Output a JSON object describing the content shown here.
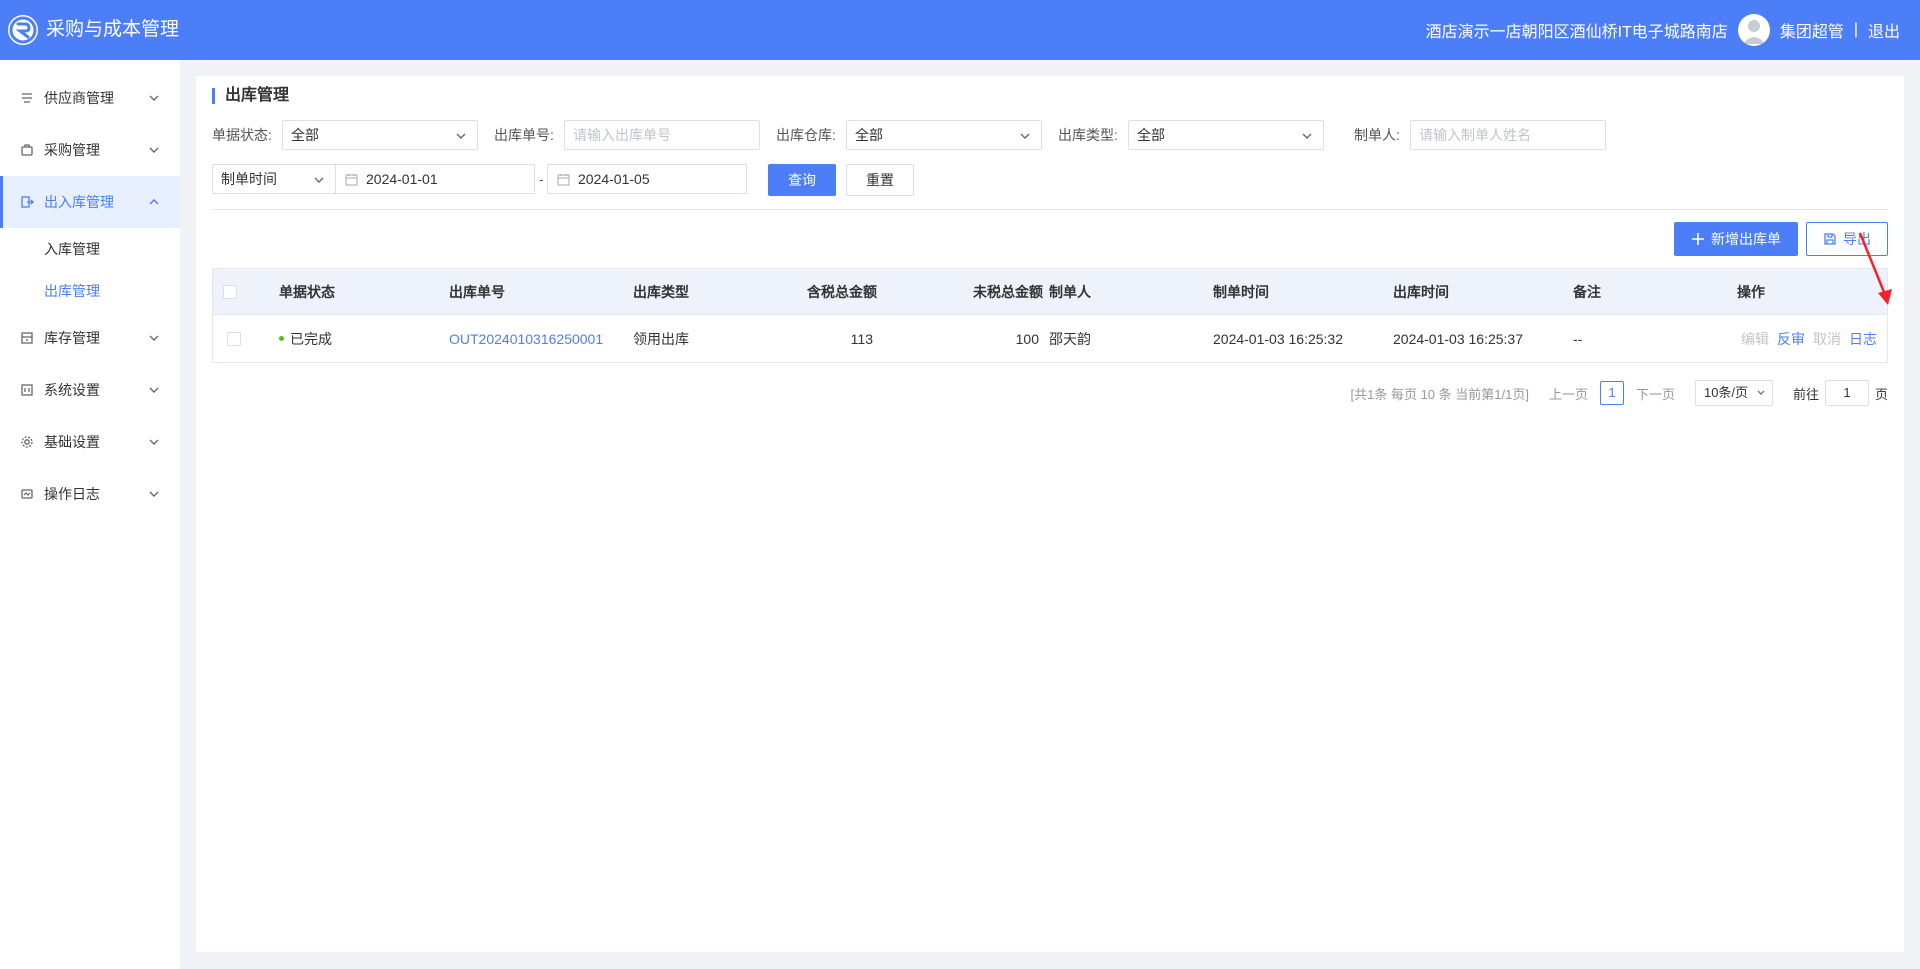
{
  "app": {
    "title": "采购与成本管理"
  },
  "header": {
    "store": "酒店演示一店朝阳区酒仙桥IT电子城路南店",
    "user": "集团超管",
    "separator": "|",
    "logout": "退出"
  },
  "sidebar": {
    "items": [
      {
        "label": "供应商管理",
        "icon": "supplier-icon"
      },
      {
        "label": "采购管理",
        "icon": "purchase-icon"
      },
      {
        "label": "出入库管理",
        "icon": "inout-icon",
        "active": true,
        "children": [
          {
            "label": "入库管理"
          },
          {
            "label": "出库管理",
            "active": true
          }
        ]
      },
      {
        "label": "库存管理",
        "icon": "inventory-icon"
      },
      {
        "label": "系统设置",
        "icon": "system-icon"
      },
      {
        "label": "基础设置",
        "icon": "gear-icon"
      },
      {
        "label": "操作日志",
        "icon": "log-icon"
      }
    ]
  },
  "page": {
    "title": "出库管理"
  },
  "filters": {
    "status": {
      "label": "单据状态:",
      "value": "全部"
    },
    "order_no": {
      "label": "出库单号:",
      "placeholder": "请输入出库单号"
    },
    "warehouse": {
      "label": "出库仓库:",
      "value": "全部"
    },
    "type": {
      "label": "出库类型:",
      "value": "全部"
    },
    "creator": {
      "label": "制单人:",
      "placeholder": "请输入制单人姓名"
    },
    "time_type": {
      "value": "制单时间"
    },
    "date_from": "2024-01-01",
    "date_sep": "-",
    "date_to": "2024-01-05",
    "query": "查询",
    "reset": "重置"
  },
  "actions": {
    "add": "新增出库单",
    "export": "导出"
  },
  "table": {
    "headers": {
      "status": "单据状态",
      "order_no": "出库单号",
      "type": "出库类型",
      "tax_total": "含税总金额",
      "notax_total": "未税总金额",
      "creator": "制单人",
      "created_at": "制单时间",
      "out_at": "出库时间",
      "remark": "备注",
      "ops": "操作"
    },
    "rows": [
      {
        "status": "已完成",
        "order_no": "OUT2024010316250001",
        "type": "领用出库",
        "tax_total": "113",
        "notax_total": "100",
        "creator": "邵天韵",
        "created_at": "2024-01-03 16:25:32",
        "out_at": "2024-01-03 16:25:37",
        "remark": "--",
        "ops": {
          "edit": "编辑",
          "reverse": "反审",
          "cancel": "取消",
          "log": "日志"
        }
      }
    ]
  },
  "pagination": {
    "summary": "[共1条 每页 10 条 当前第1/1页]",
    "prev": "上一页",
    "current": "1",
    "next": "下一页",
    "page_size": "10条/页",
    "goto_label": "前往",
    "goto_value": "1",
    "page_unit": "页"
  },
  "colors": {
    "primary": "#4c7ef7",
    "success": "#52c41a",
    "annotation": "#f5222d"
  }
}
